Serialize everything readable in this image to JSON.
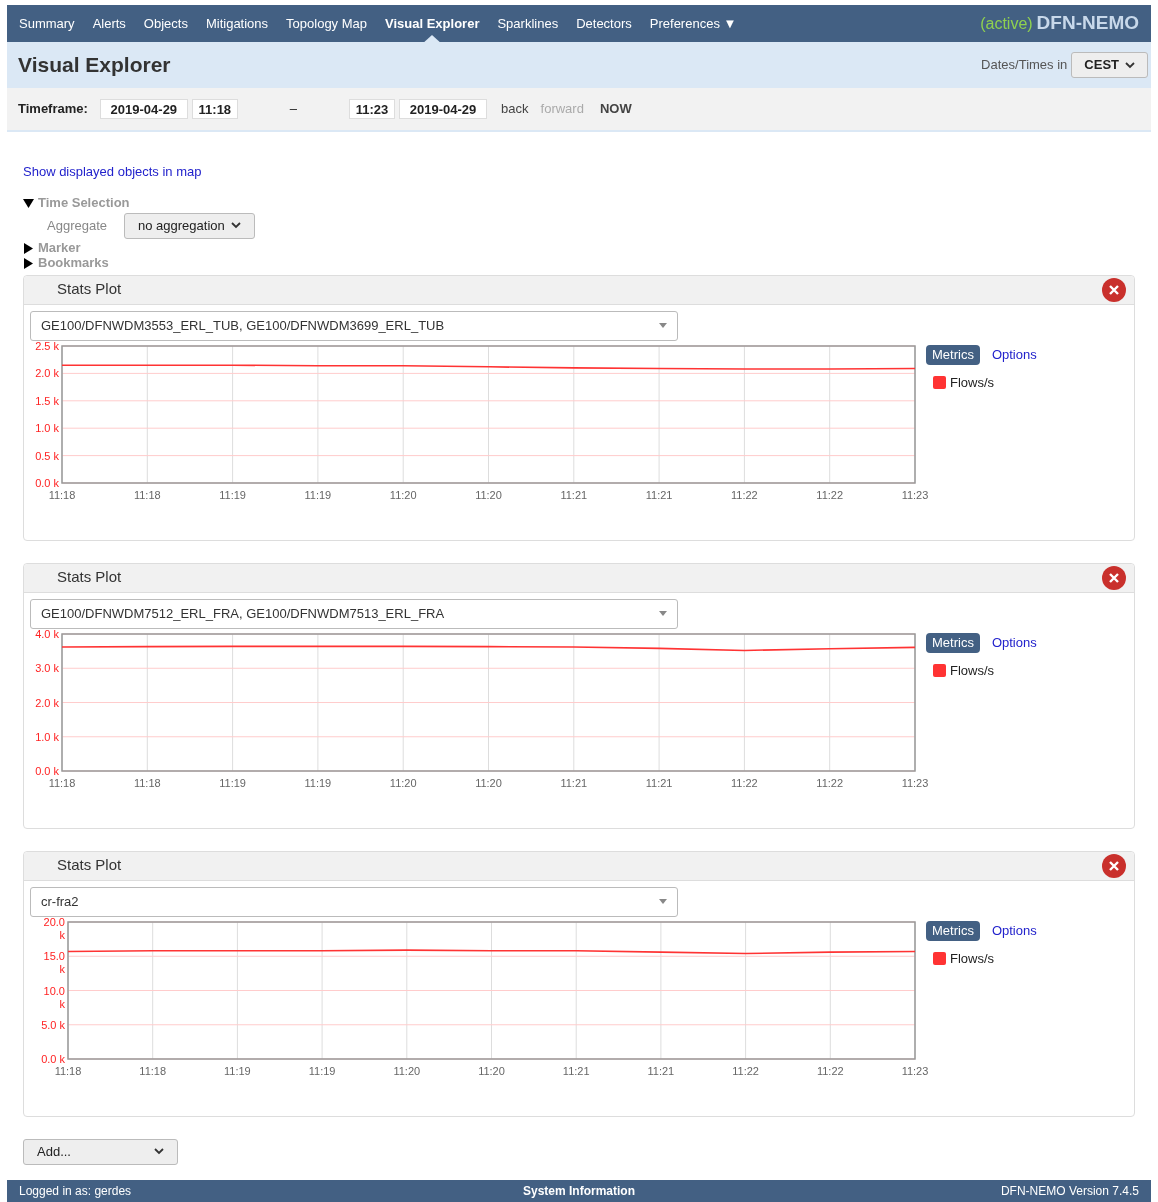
{
  "nav": {
    "items": [
      {
        "label": "Summary",
        "selected": false
      },
      {
        "label": "Alerts",
        "selected": false
      },
      {
        "label": "Objects",
        "selected": false
      },
      {
        "label": "Mitigations",
        "selected": false
      },
      {
        "label": "Topology Map",
        "selected": false
      },
      {
        "label": "Visual Explorer",
        "selected": true
      },
      {
        "label": "Sparklines",
        "selected": false
      },
      {
        "label": "Detectors",
        "selected": false
      },
      {
        "label": "Preferences ▼",
        "selected": false
      }
    ],
    "status": "(active)",
    "brand": "DFN-NEMO"
  },
  "header": {
    "title": "Visual Explorer",
    "tz_label": "Dates/Times in",
    "tz_value": "CEST"
  },
  "timeframe": {
    "label": "Timeframe:",
    "start_date": "2019-04-29",
    "start_time": "11:18",
    "dash": "–",
    "end_time": "11:23",
    "end_date": "2019-04-29",
    "links": [
      {
        "label": "back",
        "disabled": false
      },
      {
        "label": "forward",
        "disabled": true
      },
      {
        "label": "NOW",
        "disabled": false
      }
    ]
  },
  "map_link": "Show displayed objects in map",
  "sections": [
    {
      "label": "Time Selection",
      "expanded": true,
      "fields": [
        {
          "label": "Aggregate",
          "value": "no aggregation"
        }
      ]
    },
    {
      "label": "Marker",
      "expanded": false
    },
    {
      "label": "Bookmarks",
      "expanded": false
    }
  ],
  "plots": [
    {
      "title": "Stats Plot",
      "objects": "GE100/DFNWDM3553_ERL_TUB, GE100/DFNWDM3699_ERL_TUB",
      "tabs": [
        {
          "label": "Metrics",
          "selected": true
        },
        {
          "label": "Options",
          "selected": false
        }
      ],
      "chart_data": {
        "type": "line",
        "grid": true,
        "categories": [
          "11:18",
          "11:18",
          "11:19",
          "11:19",
          "11:20",
          "11:20",
          "11:21",
          "11:21",
          "11:22",
          "11:22",
          "11:23"
        ],
        "series": [
          {
            "name": "Flows/s",
            "color": "#ff3333",
            "values": [
              2150,
              2150,
              2150,
              2140,
              2140,
              2120,
              2100,
              2090,
              2080,
              2080,
              2090
            ]
          }
        ],
        "ylim": [
          0,
          2500
        ],
        "yticks": [
          {
            "value": 0,
            "label": "0.0 k"
          },
          {
            "value": 500,
            "label": "0.5 k"
          },
          {
            "value": 1000,
            "label": "1.0 k"
          },
          {
            "value": 1500,
            "label": "1.5 k"
          },
          {
            "value": 2000,
            "label": "2.0 k"
          },
          {
            "value": 2500,
            "label": "2.5 k"
          }
        ]
      }
    },
    {
      "title": "Stats Plot",
      "objects": "GE100/DFNWDM7512_ERL_FRA, GE100/DFNWDM7513_ERL_FRA",
      "tabs": [
        {
          "label": "Metrics",
          "selected": true
        },
        {
          "label": "Options",
          "selected": false
        }
      ],
      "chart_data": {
        "type": "line",
        "grid": true,
        "categories": [
          "11:18",
          "11:18",
          "11:19",
          "11:19",
          "11:20",
          "11:20",
          "11:21",
          "11:21",
          "11:22",
          "11:22",
          "11:23"
        ],
        "series": [
          {
            "name": "Flows/s",
            "color": "#ff3333",
            "values": [
              3620,
              3630,
              3640,
              3640,
              3640,
              3630,
              3620,
              3580,
              3520,
              3570,
              3610
            ]
          }
        ],
        "ylim": [
          0,
          4000
        ],
        "yticks": [
          {
            "value": 0,
            "label": "0.0 k"
          },
          {
            "value": 1000,
            "label": "1.0 k"
          },
          {
            "value": 2000,
            "label": "2.0 k"
          },
          {
            "value": 3000,
            "label": "3.0 k"
          },
          {
            "value": 4000,
            "label": "4.0 k"
          }
        ]
      }
    },
    {
      "title": "Stats Plot",
      "objects": "cr-fra2",
      "tabs": [
        {
          "label": "Metrics",
          "selected": true
        },
        {
          "label": "Options",
          "selected": false
        }
      ],
      "chart_data": {
        "type": "line",
        "grid": true,
        "categories": [
          "11:18",
          "11:18",
          "11:19",
          "11:19",
          "11:20",
          "11:20",
          "11:21",
          "11:21",
          "11:22",
          "11:22",
          "11:23"
        ],
        "series": [
          {
            "name": "Flows/s",
            "color": "#ff3333",
            "values": [
              15700,
              15800,
              15800,
              15800,
              15900,
              15800,
              15800,
              15600,
              15400,
              15600,
              15700
            ]
          }
        ],
        "ylim": [
          0,
          20000
        ],
        "yticks": [
          {
            "value": 0,
            "label": "0.0 k"
          },
          {
            "value": 5000,
            "label": "5.0 k"
          },
          {
            "value": 10000,
            "label": "10.0 k"
          },
          {
            "value": 15000,
            "label": "15.0 k"
          },
          {
            "value": 20000,
            "label": "20.0 k"
          }
        ]
      }
    }
  ],
  "add_button": "Add...",
  "footer": {
    "user": "Logged in as: gerdes",
    "center": "System Information",
    "version": "DFN-NEMO Version 7.4.5"
  }
}
